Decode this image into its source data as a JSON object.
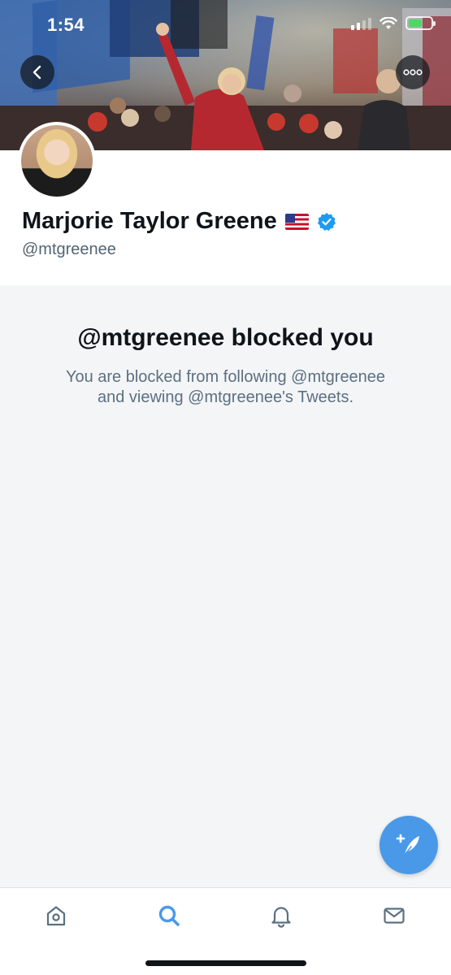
{
  "status_bar": {
    "time": "1:54",
    "icons": [
      "cellular-signal-icon",
      "wifi-icon",
      "battery-charging-icon"
    ]
  },
  "header": {
    "back_icon": "chevron-left-icon",
    "more_icon": "more-horizontal-icon"
  },
  "profile": {
    "display_name": "Marjorie Taylor Greene",
    "flag_icon": "us-flag-icon",
    "verified_icon": "verified-badge-icon",
    "handle": "@mtgreenee"
  },
  "blocked": {
    "title": "@mtgreenee blocked you",
    "description_line1": "You are blocked from following @mtgreenee",
    "description_line2": "and viewing @mtgreenee's Tweets."
  },
  "fab": {
    "icon": "compose-tweet-icon"
  },
  "tab_bar": {
    "items": [
      {
        "icon": "home-icon"
      },
      {
        "icon": "search-icon",
        "active": true
      },
      {
        "icon": "bell-icon"
      },
      {
        "icon": "mail-icon"
      }
    ]
  },
  "colors": {
    "accent": "#4a99e9",
    "verified": "#1d9bf0",
    "background": "#f4f5f7",
    "secondary_text": "#536471"
  }
}
